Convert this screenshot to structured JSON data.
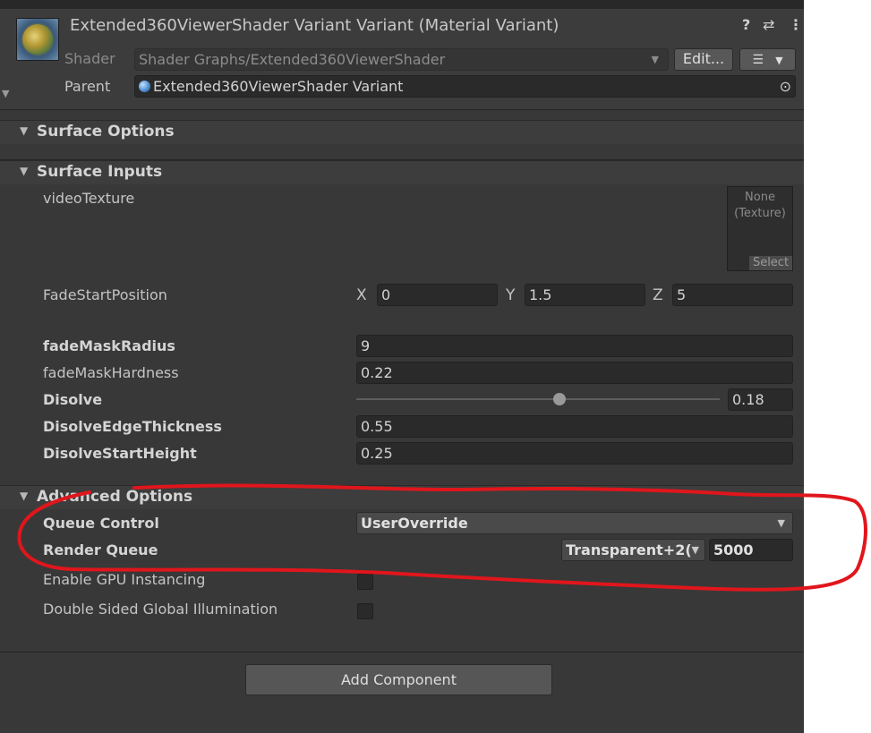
{
  "header": {
    "title": "Extended360ViewerShader Variant Variant (Material Variant)",
    "help_icon": "help-icon",
    "settings_icon": "sliders-icon",
    "more_icon": "more-icon",
    "shader_label": "Shader",
    "shader_value": "Shader Graphs/Extended360ViewerShader",
    "edit_button": "Edit...",
    "parent_label": "Parent",
    "parent_value": "Extended360ViewerShader Variant"
  },
  "sections": {
    "surface_options": "Surface Options",
    "surface_inputs": "Surface Inputs",
    "advanced_options": "Advanced Options"
  },
  "surface_inputs": {
    "video_texture_label": "videoTexture",
    "texture_none": "None",
    "texture_type": "(Texture)",
    "texture_select": "Select",
    "fade_start_label": "FadeStartPosition",
    "x_label": "X",
    "x_value": "0",
    "y_label": "Y",
    "y_value": "1.5",
    "z_label": "Z",
    "z_value": "5",
    "fade_mask_radius_label": "fadeMaskRadius",
    "fade_mask_radius_value": "9",
    "fade_mask_hardness_label": "fadeMaskHardness",
    "fade_mask_hardness_value": "0.22",
    "disolve_label": "Disolve",
    "disolve_value": "0.18",
    "disolve_edge_label": "DisolveEdgeThickness",
    "disolve_edge_value": "0.55",
    "disolve_start_label": "DisolveStartHeight",
    "disolve_start_value": "0.25"
  },
  "advanced": {
    "queue_control_label": "Queue Control",
    "queue_control_value": "UserOverride",
    "render_queue_label": "Render Queue",
    "render_queue_preset": "Transparent+2(",
    "render_queue_value": "5000",
    "gpu_instancing_label": "Enable GPU Instancing",
    "double_sided_gi_label": "Double Sided Global Illumination"
  },
  "footer": {
    "add_component": "Add Component"
  },
  "colors": {
    "panel_bg": "#383838",
    "field_bg": "#2a2a2a",
    "annotation": "#e0161c"
  }
}
